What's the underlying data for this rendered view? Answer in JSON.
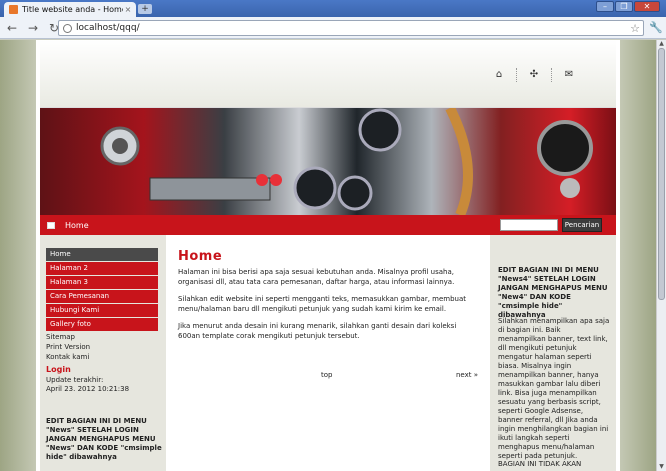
{
  "browser": {
    "tab_title": "Title website anda - Home",
    "close_glyph": "×",
    "new_tab_glyph": "+",
    "url": "localhost/qqq/",
    "win_minimize": "–",
    "win_restore": "❐",
    "win_close": "✕"
  },
  "header": {
    "icons": [
      "home-icon",
      "sitemap-icon",
      "email-icon"
    ]
  },
  "nav": {
    "home_label": "Home",
    "search_placeholder": "",
    "search_button": "Pencarian"
  },
  "sidebar": {
    "menu": [
      {
        "label": "Home",
        "active": true
      },
      {
        "label": "Halaman 2",
        "active": false
      },
      {
        "label": "Halaman 3",
        "active": false
      },
      {
        "label": "Cara Pemesanan",
        "active": false
      },
      {
        "label": "Hubungi Kami",
        "active": false
      },
      {
        "label": "Gallery foto",
        "active": false
      }
    ],
    "links": [
      "Sitemap",
      "Print Version",
      "Kontak kami"
    ],
    "login_title": "Login",
    "updated_label": "Update terakhir:",
    "updated_value": "April 23. 2012 10:21:38",
    "note": "EDIT BAGIAN INI DI MENU \"News\" SETELAH LOGIN JANGAN MENGHAPUS MENU \"News\" DAN KODE \"cmsimple hide\" dibawahnya"
  },
  "main": {
    "title": "Home",
    "p1": "Halaman ini bisa berisi apa saja sesuai kebutuhan anda. Misalnya profil usaha, organisasi dll, atau tata cara pemesanan, daftar harga, atau informasi lainnya.",
    "p2": "Silahkan edit website ini seperti mengganti teks, memasukkan gambar, membuat menu/halaman baru dll mengikuti petunjuk yang sudah kami kirim ke email.",
    "p3": "Jika menurut anda desain ini kurang menarik, silahkan ganti desain dari koleksi 600an template corak mengikuti petunjuk tersebut.",
    "top_link": "top",
    "next_link": "next »"
  },
  "right": {
    "title": "EDIT BAGIAN INI DI MENU \"News4\" SETELAH LOGIN JANGAN MENGHAPUS MENU \"New4\" DAN KODE \"cmsimple hide\" dibawahnya",
    "body": "Silahkan menampilkan apa saja di bagian ini. Baik menampilkan banner, text link, dll mengikuti petunjuk mengatur halaman seperti biasa. Misalnya ingin menampilkan banner, hanya masukkan gambar lalu diberi link. Bisa juga menampilkan sesuatu yang berbasis script, seperti Google Adsense, banner referral, dll Jika anda ingin menghilangkan bagian ini ikuti langkah seperti menghapus menu/halaman seperti pada petunjuk.",
    "foot": "BAGIAN INI TIDAK AKAN"
  }
}
